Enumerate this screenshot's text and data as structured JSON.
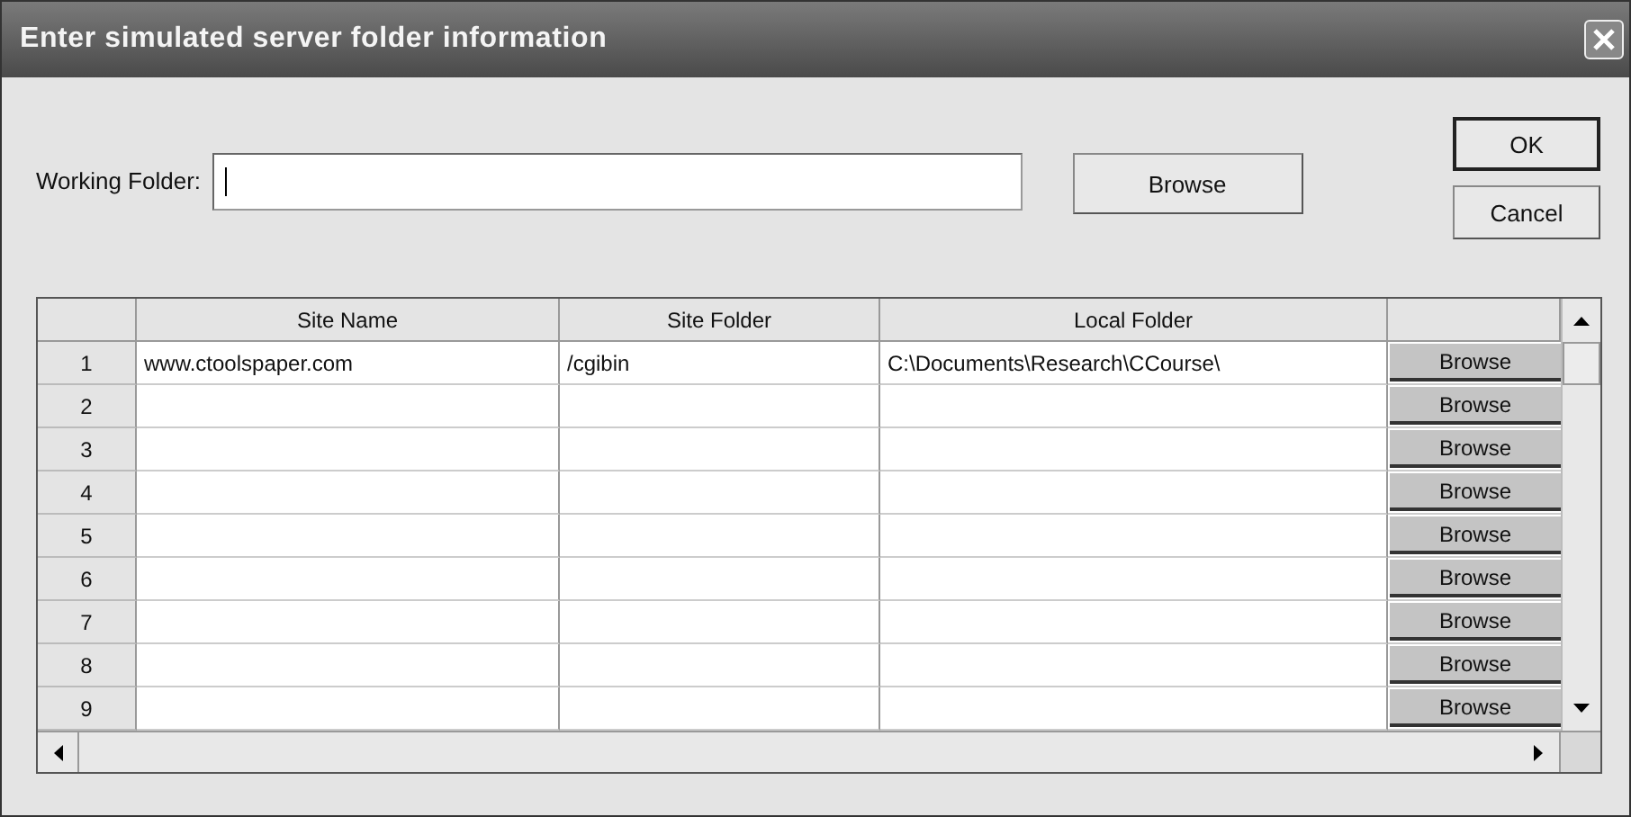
{
  "window": {
    "title": "Enter simulated server folder information"
  },
  "working_folder": {
    "label": "Working Folder:",
    "focused": true,
    "browse": "Browse"
  },
  "buttons": [
    {
      "label": "OK",
      "default": true
    },
    {
      "label": "Cancel",
      "default": false
    }
  ],
  "table": {
    "columns": [
      "Site Name",
      "Site Folder",
      "Local Folder"
    ],
    "rows": [
      {
        "number": "1",
        "site_name": "www.ctoolspaper.com",
        "site_folder": "/cgibin",
        "local_folder": "C:\\Documents\\Research\\CCourse\\",
        "button": "Browse"
      },
      {
        "number": "2",
        "button": "Browse"
      },
      {
        "number": "3",
        "button": "Browse"
      },
      {
        "number": "4",
        "button": "Browse"
      },
      {
        "number": "5",
        "button": "Browse"
      },
      {
        "number": "6",
        "button": "Browse"
      },
      {
        "number": "7",
        "button": "Browse"
      },
      {
        "number": "8",
        "button": "Browse"
      },
      {
        "number": "9",
        "button": "Browse"
      }
    ]
  }
}
